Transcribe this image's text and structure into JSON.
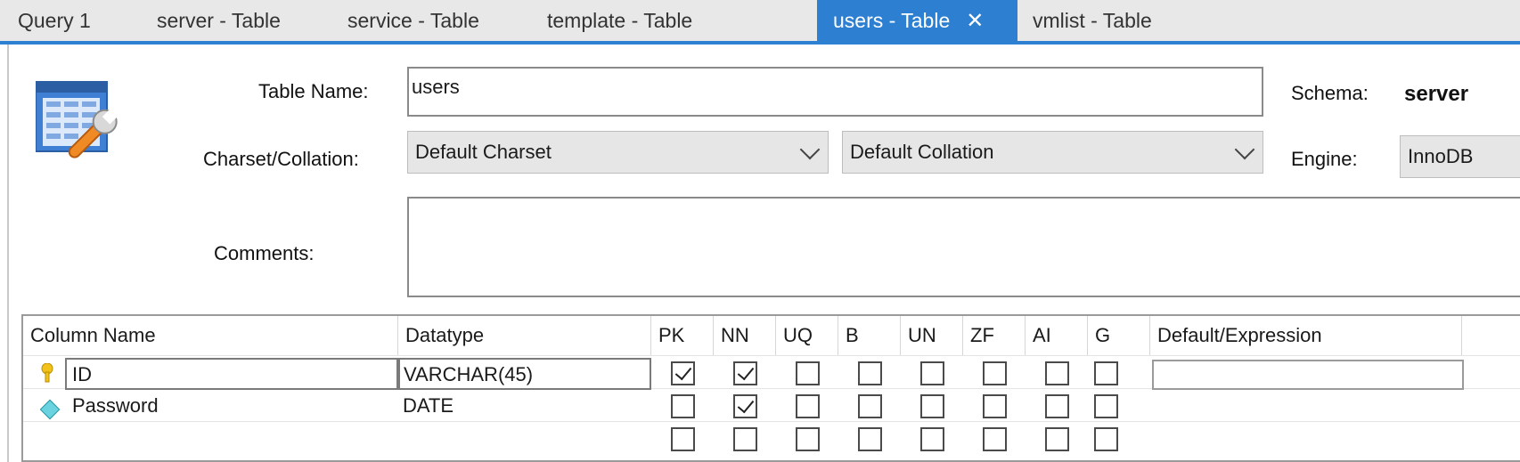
{
  "tabs": [
    {
      "label": "Query 1",
      "active": false
    },
    {
      "label": "server - Table",
      "active": false
    },
    {
      "label": "service - Table",
      "active": false
    },
    {
      "label": "template - Table",
      "active": false
    },
    {
      "label": "users - Table",
      "active": true
    },
    {
      "label": "vmlist - Table",
      "active": false
    }
  ],
  "form": {
    "table_name_label": "Table Name:",
    "table_name_value": "users",
    "schema_label": "Schema:",
    "schema_value": "server",
    "charset_label": "Charset/Collation:",
    "charset_value": "Default Charset",
    "collation_value": "Default Collation",
    "engine_label": "Engine:",
    "engine_value": "InnoDB",
    "comments_label": "Comments:",
    "comments_value": ""
  },
  "grid": {
    "headers": {
      "column_name": "Column Name",
      "datatype": "Datatype",
      "pk": "PK",
      "nn": "NN",
      "uq": "UQ",
      "b": "B",
      "un": "UN",
      "zf": "ZF",
      "ai": "AI",
      "g": "G",
      "default": "Default/Expression"
    },
    "rows": [
      {
        "name": "ID",
        "datatype": "VARCHAR(45)",
        "icon": "key-icon",
        "flags": {
          "pk": true,
          "nn": true,
          "uq": false,
          "b": false,
          "un": false,
          "zf": false,
          "ai": false,
          "g": false
        },
        "default": ""
      },
      {
        "name": "Password",
        "datatype": "DATE",
        "icon": "diamond-icon",
        "flags": {
          "pk": false,
          "nn": true,
          "uq": false,
          "b": false,
          "un": false,
          "zf": false,
          "ai": false,
          "g": false
        },
        "default": ""
      },
      {
        "name": "",
        "datatype": "",
        "icon": "",
        "flags": {
          "pk": false,
          "nn": false,
          "uq": false,
          "b": false,
          "un": false,
          "zf": false,
          "ai": false,
          "g": false
        },
        "default": ""
      }
    ]
  },
  "colors": {
    "accent": "#2d7fd1"
  }
}
